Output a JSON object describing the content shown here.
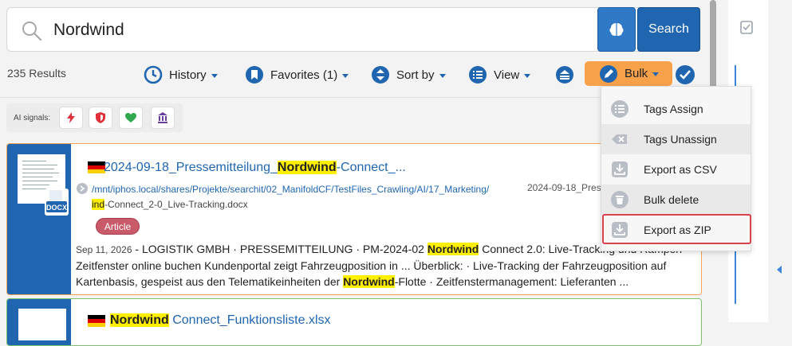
{
  "search": {
    "value": "Nordwind",
    "button_label": "Search"
  },
  "results": {
    "count_label": "235 Results"
  },
  "toolbar": {
    "history_label": "History",
    "favorites_label": "Favorites (1)",
    "sort_label": "Sort by",
    "view_label": "View",
    "bulk_label": "Bulk"
  },
  "ai_signals": {
    "label": "AI signals:"
  },
  "bulk_menu": {
    "items": [
      {
        "label": "Tags Assign",
        "icon": "tags-assign-icon"
      },
      {
        "label": "Tags Unassign",
        "icon": "tags-unassign-icon"
      },
      {
        "label": "Export as CSV",
        "icon": "export-icon"
      },
      {
        "label": "Bulk delete",
        "icon": "trash-icon"
      },
      {
        "label": "Export as ZIP",
        "icon": "export-icon"
      }
    ]
  },
  "result1": {
    "title_pre": "2024-09-18_Pressemitteilung_",
    "title_hl": "Nordwind",
    "title_post": "-Connect_...",
    "path_line1": "/mnt/iphos.local/shares/Projekte/searchit/02_ManifoldCF/TestFiles_Crawling/AI/17_Marketing/",
    "path_hl": "ind",
    "path_line2": "-Connect_2-0_Live-Tracking.docx",
    "path_date": "2024-09-18_Pres",
    "badge": "Article",
    "file_type": "DOCX",
    "date": "Sep 11, 2026",
    "snippet_a": " -  LOGISTIK GMBH · PRESSEMITTEILUNG · PM-2024-02 ",
    "snippet_hl1": "Nordwind",
    "snippet_b": " Connect 2.0: Live-Tracking und Rampen Zeitfenster online buchen Kundenportal zeigt Fahrzeugposition in ... Überblick: · Live-Tracking der Fahrzeugposition auf Kartenbasis, gespeist aus den Telematikeinheiten der ",
    "snippet_hl2": "Nordwind",
    "snippet_c": "-Flotte · Zeitfenstermanagement: Lieferanten ..."
  },
  "result2": {
    "title_hl": "Nordwind",
    "title_post": " Connect_Funktionsliste.xlsx"
  },
  "colors": {
    "accent": "#1f65b0",
    "bulk": "#f7a24b",
    "highlight": "#ffef00",
    "focus": "#d8424b"
  }
}
